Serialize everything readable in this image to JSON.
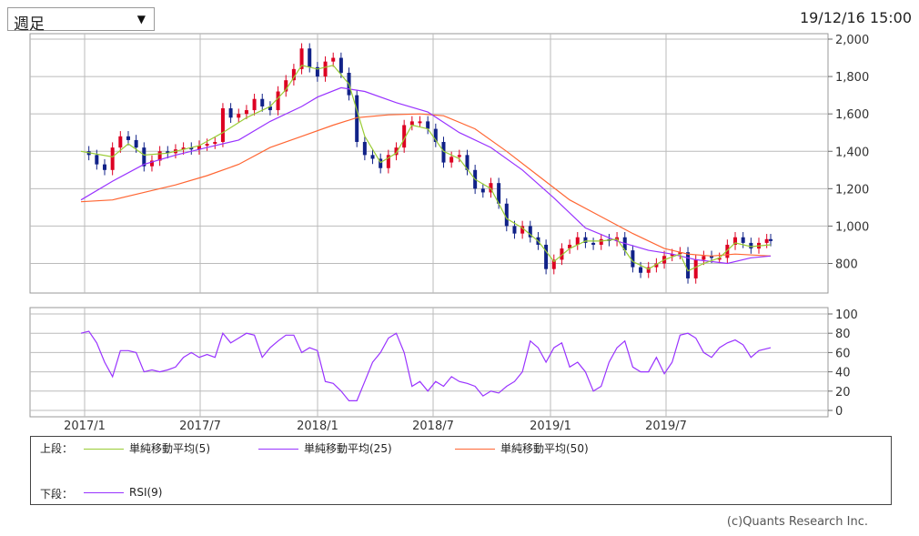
{
  "header": {
    "period_select_value": "週足",
    "timestamp": "19/12/16 15:00"
  },
  "legend": {
    "upper_label": "上段：",
    "lower_label": "下段：",
    "items": [
      {
        "label": "単純移動平均(5)",
        "color": "#99cc33"
      },
      {
        "label": "単純移動平均(25)",
        "color": "#9933ff"
      },
      {
        "label": "単純移動平均(50)",
        "color": "#ff6633"
      },
      {
        "label": "RSI(9)",
        "color": "#9933ff"
      }
    ]
  },
  "copyright": "(c)Quants Research Inc.",
  "colors": {
    "up": "#dd0022",
    "down": "#112288",
    "grid": "#bbbbbb"
  },
  "chart_data": [
    {
      "type": "candlestick",
      "x_ticks": [
        "2017/1",
        "2017/7",
        "2018/1",
        "2018/7",
        "2019/1",
        "2019/7"
      ],
      "y_ticks": [
        "2,000",
        "1,800",
        "1,600",
        "1,400",
        "1,200",
        "1,000",
        "800"
      ],
      "ylim": [
        670,
        2010
      ],
      "price": [
        [
          0,
          1400
        ],
        [
          2,
          1380
        ],
        [
          4,
          1330
        ],
        [
          6,
          1300
        ],
        [
          8,
          1420
        ],
        [
          10,
          1480
        ],
        [
          12,
          1460
        ],
        [
          14,
          1420
        ],
        [
          16,
          1320
        ],
        [
          18,
          1350
        ],
        [
          20,
          1400
        ],
        [
          22,
          1390
        ],
        [
          24,
          1410
        ],
        [
          26,
          1420
        ],
        [
          28,
          1410
        ],
        [
          30,
          1430
        ],
        [
          32,
          1440
        ],
        [
          34,
          1450
        ],
        [
          36,
          1630
        ],
        [
          38,
          1580
        ],
        [
          40,
          1600
        ],
        [
          42,
          1620
        ],
        [
          44,
          1680
        ],
        [
          46,
          1640
        ],
        [
          48,
          1620
        ],
        [
          50,
          1720
        ],
        [
          52,
          1780
        ],
        [
          54,
          1840
        ],
        [
          56,
          1950
        ],
        [
          58,
          1850
        ],
        [
          60,
          1800
        ],
        [
          62,
          1880
        ],
        [
          64,
          1900
        ],
        [
          66,
          1820
        ],
        [
          68,
          1700
        ],
        [
          70,
          1450
        ],
        [
          72,
          1380
        ],
        [
          74,
          1360
        ],
        [
          76,
          1310
        ],
        [
          78,
          1380
        ],
        [
          80,
          1420
        ],
        [
          82,
          1540
        ],
        [
          84,
          1560
        ],
        [
          86,
          1560
        ],
        [
          88,
          1520
        ],
        [
          90,
          1450
        ],
        [
          92,
          1340
        ],
        [
          94,
          1370
        ],
        [
          96,
          1380
        ],
        [
          98,
          1300
        ],
        [
          100,
          1200
        ],
        [
          102,
          1180
        ],
        [
          104,
          1230
        ],
        [
          106,
          1120
        ],
        [
          108,
          1000
        ],
        [
          110,
          960
        ],
        [
          112,
          1000
        ],
        [
          114,
          940
        ],
        [
          116,
          900
        ],
        [
          118,
          770
        ],
        [
          120,
          820
        ],
        [
          122,
          880
        ],
        [
          124,
          900
        ],
        [
          126,
          940
        ],
        [
          128,
          910
        ],
        [
          130,
          900
        ],
        [
          132,
          930
        ],
        [
          134,
          920
        ],
        [
          136,
          940
        ],
        [
          138,
          870
        ],
        [
          140,
          780
        ],
        [
          142,
          750
        ],
        [
          144,
          780
        ],
        [
          146,
          800
        ],
        [
          148,
          840
        ],
        [
          150,
          850
        ],
        [
          152,
          860
        ],
        [
          154,
          720
        ],
        [
          156,
          820
        ],
        [
          158,
          840
        ],
        [
          160,
          830
        ],
        [
          162,
          830
        ],
        [
          164,
          900
        ],
        [
          166,
          940
        ],
        [
          168,
          910
        ],
        [
          170,
          880
        ],
        [
          172,
          910
        ],
        [
          174,
          930
        ],
        [
          175,
          920
        ]
      ],
      "series": [
        {
          "name": "単純移動平均(5)",
          "points": [
            [
              0,
              1400
            ],
            [
              8,
              1370
            ],
            [
              12,
              1440
            ],
            [
              16,
              1380
            ],
            [
              22,
              1390
            ],
            [
              30,
              1430
            ],
            [
              36,
              1500
            ],
            [
              42,
              1580
            ],
            [
              48,
              1640
            ],
            [
              52,
              1730
            ],
            [
              56,
              1860
            ],
            [
              60,
              1840
            ],
            [
              64,
              1860
            ],
            [
              68,
              1760
            ],
            [
              72,
              1480
            ],
            [
              76,
              1340
            ],
            [
              80,
              1390
            ],
            [
              84,
              1540
            ],
            [
              88,
              1520
            ],
            [
              92,
              1400
            ],
            [
              96,
              1360
            ],
            [
              100,
              1250
            ],
            [
              104,
              1200
            ],
            [
              108,
              1040
            ],
            [
              112,
              990
            ],
            [
              116,
              920
            ],
            [
              120,
              810
            ],
            [
              124,
              880
            ],
            [
              128,
              920
            ],
            [
              132,
              920
            ],
            [
              136,
              930
            ],
            [
              140,
              810
            ],
            [
              144,
              770
            ],
            [
              148,
              820
            ],
            [
              152,
              850
            ],
            [
              154,
              760
            ],
            [
              158,
              800
            ],
            [
              162,
              830
            ],
            [
              166,
              910
            ],
            [
              170,
              890
            ],
            [
              175,
              900
            ]
          ]
        },
        {
          "name": "単純移動平均(25)",
          "points": [
            [
              0,
              1140
            ],
            [
              8,
              1240
            ],
            [
              16,
              1330
            ],
            [
              24,
              1380
            ],
            [
              32,
              1420
            ],
            [
              40,
              1460
            ],
            [
              48,
              1560
            ],
            [
              56,
              1640
            ],
            [
              60,
              1690
            ],
            [
              66,
              1740
            ],
            [
              72,
              1720
            ],
            [
              80,
              1660
            ],
            [
              88,
              1610
            ],
            [
              96,
              1500
            ],
            [
              104,
              1420
            ],
            [
              112,
              1300
            ],
            [
              120,
              1150
            ],
            [
              128,
              990
            ],
            [
              136,
              920
            ],
            [
              144,
              870
            ],
            [
              150,
              850
            ],
            [
              156,
              820
            ],
            [
              164,
              800
            ],
            [
              170,
              830
            ],
            [
              175,
              840
            ]
          ]
        },
        {
          "name": "単純移動平均(50)",
          "points": [
            [
              0,
              1130
            ],
            [
              8,
              1140
            ],
            [
              16,
              1180
            ],
            [
              24,
              1220
            ],
            [
              32,
              1270
            ],
            [
              40,
              1330
            ],
            [
              48,
              1420
            ],
            [
              56,
              1480
            ],
            [
              64,
              1540
            ],
            [
              70,
              1580
            ],
            [
              78,
              1595
            ],
            [
              86,
              1600
            ],
            [
              92,
              1590
            ],
            [
              100,
              1520
            ],
            [
              108,
              1400
            ],
            [
              116,
              1270
            ],
            [
              124,
              1140
            ],
            [
              132,
              1050
            ],
            [
              140,
              960
            ],
            [
              148,
              880
            ],
            [
              154,
              850
            ],
            [
              160,
              840
            ],
            [
              166,
              850
            ],
            [
              175,
              840
            ]
          ]
        }
      ]
    },
    {
      "type": "line",
      "y_ticks": [
        "100",
        "80",
        "60",
        "40",
        "20",
        "0"
      ],
      "ylim": [
        0,
        100
      ],
      "series": [
        {
          "name": "RSI(9)",
          "points": [
            [
              0,
              80
            ],
            [
              2,
              82
            ],
            [
              4,
              70
            ],
            [
              6,
              50
            ],
            [
              8,
              35
            ],
            [
              10,
              62
            ],
            [
              12,
              62
            ],
            [
              14,
              60
            ],
            [
              16,
              40
            ],
            [
              18,
              42
            ],
            [
              20,
              40
            ],
            [
              22,
              42
            ],
            [
              24,
              45
            ],
            [
              26,
              55
            ],
            [
              28,
              60
            ],
            [
              30,
              55
            ],
            [
              32,
              58
            ],
            [
              34,
              55
            ],
            [
              36,
              80
            ],
            [
              38,
              70
            ],
            [
              40,
              75
            ],
            [
              42,
              80
            ],
            [
              44,
              78
            ],
            [
              46,
              55
            ],
            [
              48,
              65
            ],
            [
              50,
              72
            ],
            [
              52,
              78
            ],
            [
              54,
              78
            ],
            [
              56,
              60
            ],
            [
              58,
              65
            ],
            [
              60,
              62
            ],
            [
              62,
              30
            ],
            [
              64,
              28
            ],
            [
              66,
              20
            ],
            [
              68,
              10
            ],
            [
              70,
              10
            ],
            [
              72,
              30
            ],
            [
              74,
              50
            ],
            [
              76,
              60
            ],
            [
              78,
              75
            ],
            [
              80,
              80
            ],
            [
              82,
              60
            ],
            [
              84,
              25
            ],
            [
              86,
              30
            ],
            [
              88,
              20
            ],
            [
              90,
              30
            ],
            [
              92,
              25
            ],
            [
              94,
              35
            ],
            [
              96,
              30
            ],
            [
              98,
              28
            ],
            [
              100,
              25
            ],
            [
              102,
              15
            ],
            [
              104,
              20
            ],
            [
              106,
              18
            ],
            [
              108,
              25
            ],
            [
              110,
              30
            ],
            [
              112,
              40
            ],
            [
              114,
              72
            ],
            [
              116,
              65
            ],
            [
              118,
              50
            ],
            [
              120,
              65
            ],
            [
              122,
              70
            ],
            [
              124,
              45
            ],
            [
              126,
              50
            ],
            [
              128,
              40
            ],
            [
              130,
              20
            ],
            [
              132,
              25
            ],
            [
              134,
              50
            ],
            [
              136,
              65
            ],
            [
              138,
              72
            ],
            [
              140,
              45
            ],
            [
              142,
              40
            ],
            [
              144,
              40
            ],
            [
              146,
              55
            ],
            [
              148,
              38
            ],
            [
              150,
              50
            ],
            [
              152,
              78
            ],
            [
              154,
              80
            ],
            [
              156,
              75
            ],
            [
              158,
              60
            ],
            [
              160,
              55
            ],
            [
              162,
              65
            ],
            [
              164,
              70
            ],
            [
              166,
              73
            ],
            [
              168,
              68
            ],
            [
              170,
              55
            ],
            [
              172,
              62
            ],
            [
              175,
              65
            ]
          ]
        }
      ]
    }
  ]
}
